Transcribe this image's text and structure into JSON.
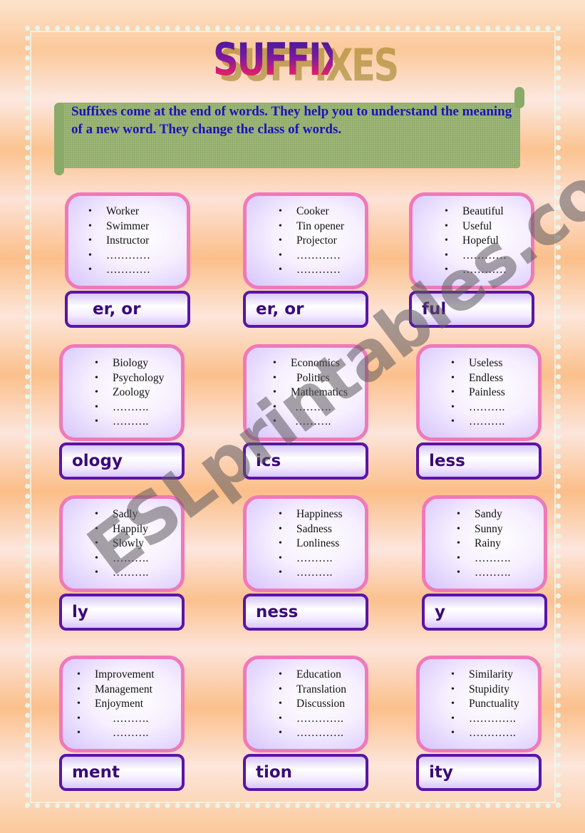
{
  "title": "SUFFIXES",
  "intro": "Suffixes come at the end of words. They help you to understand the meaning of a new word. They change the class of words.",
  "watermark": "ESLprintables.com",
  "bullet": "•",
  "cards": [
    {
      "suffix": "er, or",
      "words": [
        "Worker",
        "Swimmer",
        "Instructor",
        "…………",
        "…………"
      ]
    },
    {
      "suffix": "er, or",
      "words": [
        "Cooker",
        "Tin opener",
        "Projector",
        "…………",
        "…………"
      ]
    },
    {
      "suffix": "ful",
      "words": [
        "Beautiful",
        "Useful",
        "Hopeful",
        "…………",
        "…………"
      ]
    },
    {
      "suffix": "ology",
      "words": [
        "Biology",
        "Psychology",
        "Zoology",
        "……….",
        "………."
      ]
    },
    {
      "suffix": "ics",
      "words": [
        "Economics",
        "Politics",
        "Mathematics",
        "……….",
        "………."
      ]
    },
    {
      "suffix": "less",
      "words": [
        "Useless",
        "Endless",
        "Painless",
        "……….",
        "………."
      ]
    },
    {
      "suffix": "ly",
      "words": [
        "Sadly",
        "Happily",
        "Slowly",
        "……….",
        "………."
      ]
    },
    {
      "suffix": "ness",
      "words": [
        "Happiness",
        "Sadness",
        "Lonliness",
        "……….",
        "………."
      ]
    },
    {
      "suffix": "y",
      "words": [
        "Sandy",
        "Sunny",
        "Rainy",
        "……….",
        "………."
      ]
    },
    {
      "suffix": "ment",
      "words": [
        "Improvement",
        "Management",
        "Enjoyment",
        "……….",
        "………."
      ]
    },
    {
      "suffix": "tion",
      "words": [
        "Education",
        "Translation",
        "Discussion",
        "………….",
        "…………."
      ]
    },
    {
      "suffix": "ity",
      "words": [
        "Similarity",
        "Stupidity",
        "Punctuality",
        "………….",
        "…………."
      ]
    }
  ]
}
